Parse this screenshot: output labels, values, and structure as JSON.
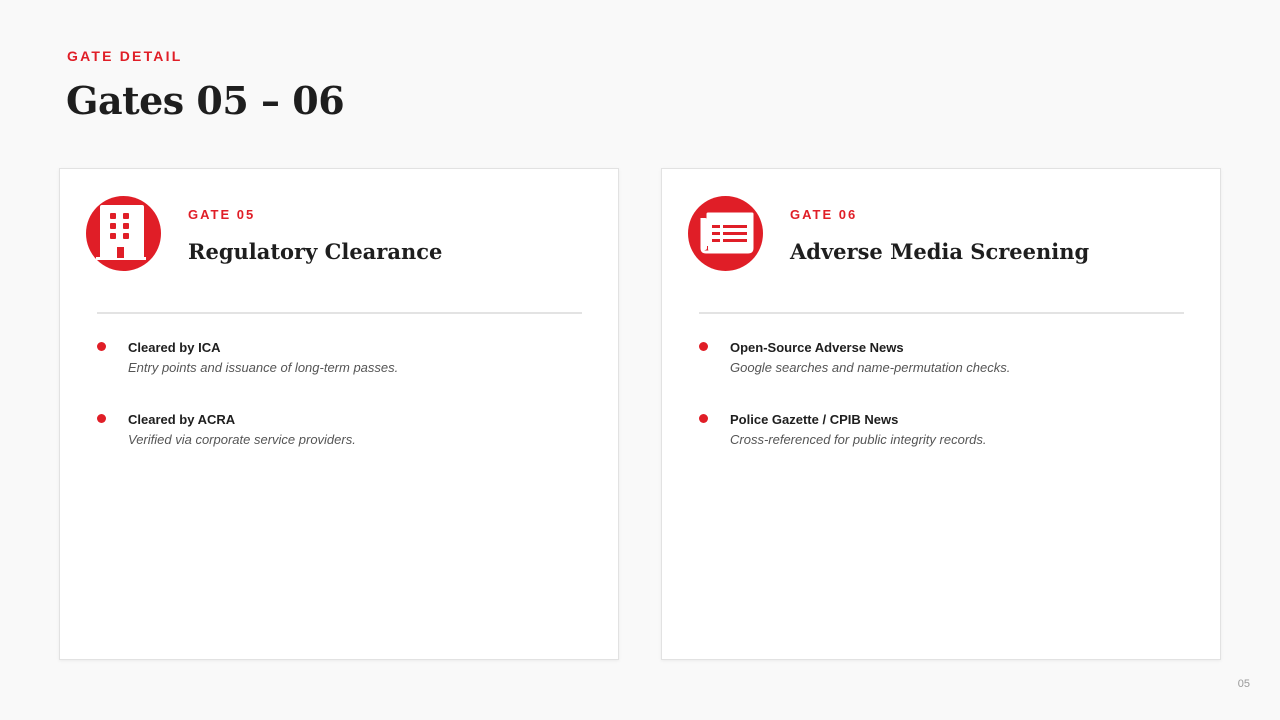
{
  "header": {
    "eyebrow": "GATE DETAIL",
    "title": "Gates 05 – 06"
  },
  "cards": [
    {
      "gate_label": "GATE 05",
      "title": "Regulatory Clearance",
      "icon": "building-icon",
      "items": [
        {
          "title": "Cleared by ICA",
          "description": "Entry points and issuance of long-term passes."
        },
        {
          "title": "Cleared by ACRA",
          "description": "Verified via corporate service providers."
        }
      ]
    },
    {
      "gate_label": "GATE 06",
      "title": "Adverse Media Screening",
      "icon": "newspaper-icon",
      "items": [
        {
          "title": "Open-Source Adverse News",
          "description": "Google searches and name-permutation checks."
        },
        {
          "title": "Police Gazette / CPIB News",
          "description": "Cross-referenced for public integrity records."
        }
      ]
    }
  ],
  "page_number": "05",
  "colors": {
    "accent": "#e01e27",
    "background": "#f9f9f9",
    "card": "#ffffff"
  }
}
